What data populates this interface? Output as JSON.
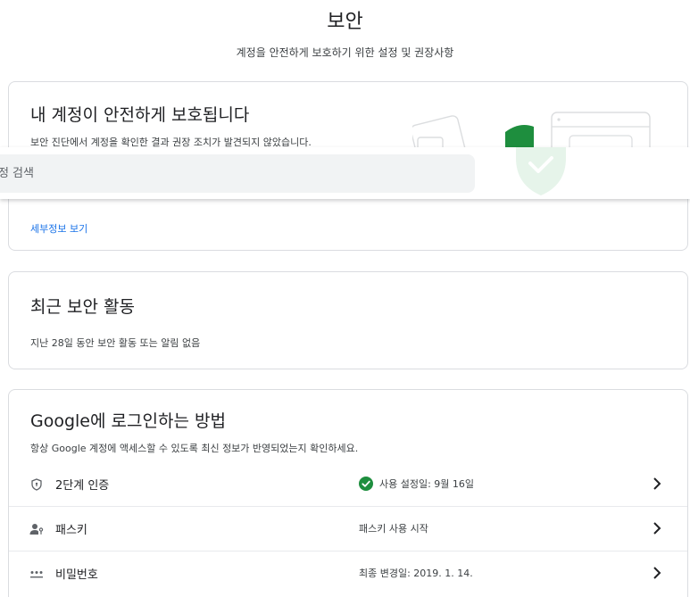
{
  "header": {
    "title": "보안",
    "subtitle": "계정을 안전하게 보호하기 위한 설정 및 권장사항"
  },
  "status_card": {
    "title": "내 계정이 안전하게 보호됩니다",
    "description": "보안 진단에서 계정을 확인한 결과 권장 조치가 발견되지 않았습니다.",
    "details_link": "세부정보 보기",
    "shield_icon": "shield-check-icon",
    "accent_color": "#1e8e3e"
  },
  "search": {
    "placeholder": "설정 검색"
  },
  "recent_activity": {
    "title": "최근 보안 활동",
    "description": "지난 28일 동안 보안 활동 또는 알림 없음"
  },
  "signin": {
    "title": "Google에 로그인하는 방법",
    "description": "항상 Google 계정에 액세스할 수 있도록 최신 정보가 반영되었는지 확인하세요.",
    "rows": [
      {
        "icon": "shield-icon",
        "label": "2단계 인증",
        "value": "사용 설정일: 9월 16일",
        "status_icon": "check-circle-icon"
      },
      {
        "icon": "passkey-icon",
        "label": "패스키",
        "value": "패스키 사용 시작"
      },
      {
        "icon": "password-dots-icon",
        "label": "비밀번호",
        "value": "최종 변경일: 2019. 1. 14."
      }
    ]
  }
}
